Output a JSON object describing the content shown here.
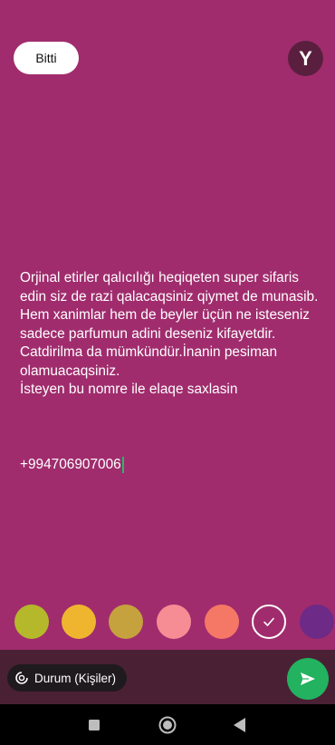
{
  "header": {
    "done_label": "Bitti",
    "avatar_letter": "Y"
  },
  "status": {
    "text": "Orjinal etirler qalıcılığı heqiqeten super sifaris edin siz de razi qalacaqsiniz qiymet de munasib.\nHem xanimlar hem de beyler üçün ne isteseniz sadece parfumun adini deseniz kifayetdir.\nCatdirilma da mümkündür.İnanin pesiman olamuacaqsiniz.\nİsteyen bu nomre ile elaqe saxlasin",
    "phone": "+994706907006"
  },
  "palette": {
    "colors": [
      "#b5b82a",
      "#efb52f",
      "#c5a23e",
      "#f68d94",
      "#f57866",
      "#a02c6d",
      "#6d2a86"
    ],
    "selected_index": 5
  },
  "composer": {
    "audience_label": "Durum (Kişiler)",
    "send_icon": "send-icon",
    "audience_icon": "privacy-icon"
  },
  "navbar": {
    "icons": [
      "recents-icon",
      "home-icon",
      "back-icon"
    ]
  },
  "colors": {
    "background": "#a02c6d",
    "composer_bg": "#4a2035",
    "send_button": "#23b25f",
    "avatar_bg": "#5a1f3f"
  }
}
